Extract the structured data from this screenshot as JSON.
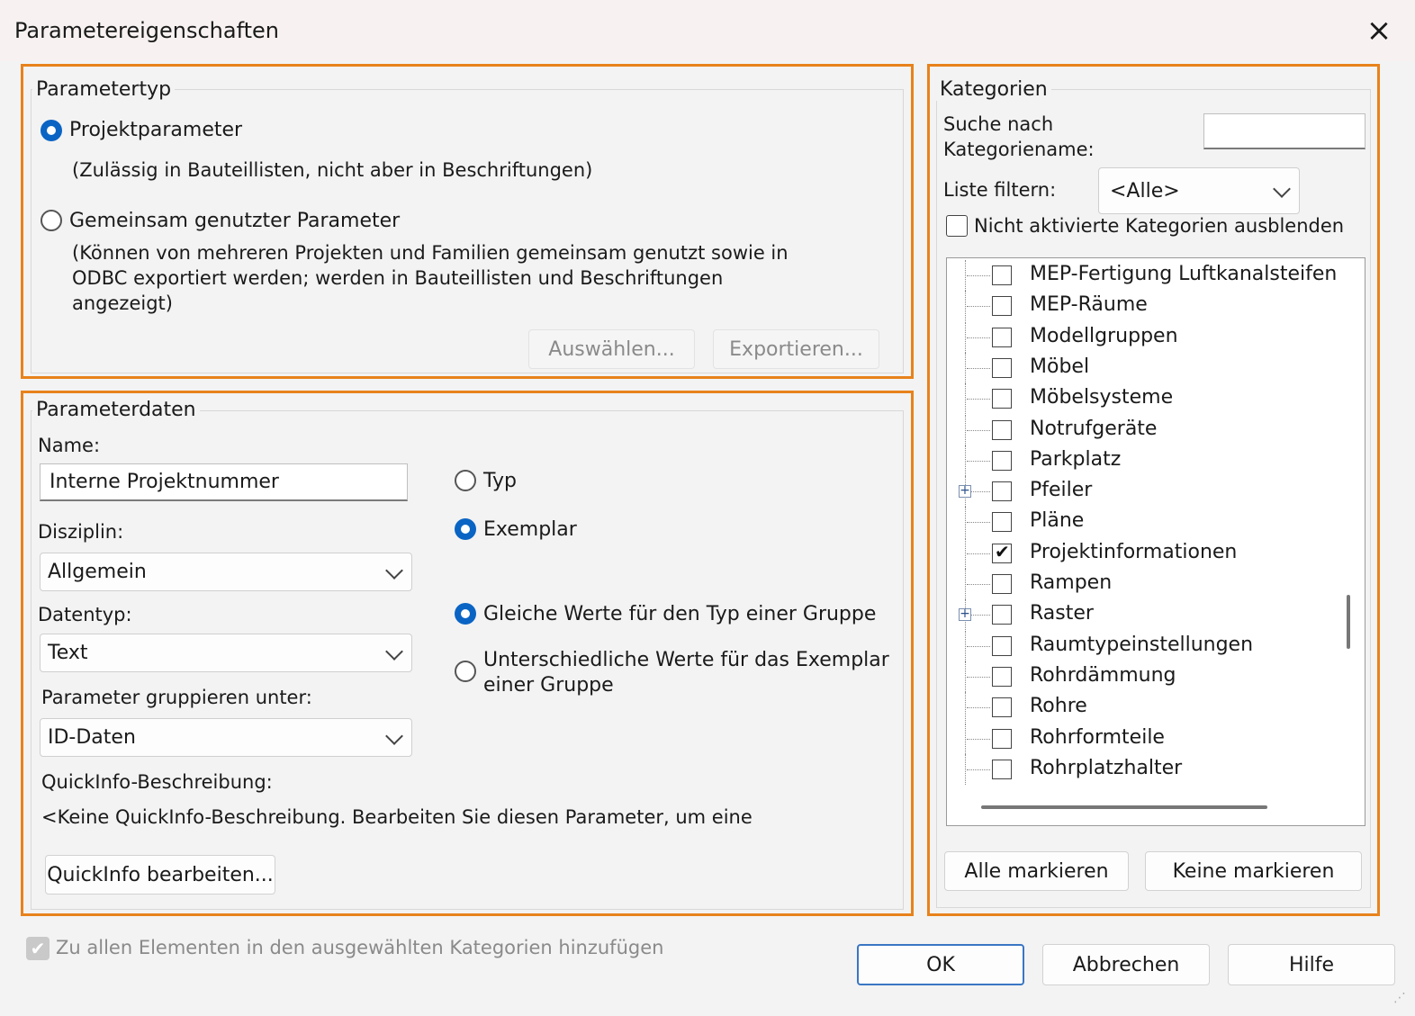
{
  "window": {
    "title": "Parametereigenschaften",
    "close_glyph": "×"
  },
  "parametertyp": {
    "legend": "Parametertyp",
    "projekt": {
      "label": "Projektparameter",
      "selected": true,
      "desc": "(Zulässig in Bauteillisten, nicht aber in Beschriftungen)"
    },
    "gemeinsam": {
      "label": "Gemeinsam genutzter Parameter",
      "selected": false,
      "desc_lines": [
        "(Können von mehreren Projekten und Familien gemeinsam genutzt sowie in",
        "ODBC exportiert werden; werden in Bauteillisten und Beschriftungen",
        "angezeigt)"
      ]
    },
    "auswaehlen_button": "Auswählen...",
    "exportieren_button": "Exportieren..."
  },
  "parameterdaten": {
    "legend": "Parameterdaten",
    "name_label": "Name:",
    "name_value": "Interne Projektnummer",
    "disziplin_label": "Disziplin:",
    "disziplin_value": "Allgemein",
    "datentyp_label": "Datentyp:",
    "datentyp_value": "Text",
    "gruppieren_label": "Parameter gruppieren unter:",
    "gruppieren_value": "ID-Daten",
    "typ_radio": {
      "label": "Typ",
      "selected": false
    },
    "exemplar_radio": {
      "label": "Exemplar",
      "selected": true
    },
    "gleiche_radio": {
      "label": "Gleiche Werte für den Typ einer Gruppe",
      "selected": true
    },
    "unterschiedliche_radio": {
      "label_line1": "Unterschiedliche Werte für das Exemplar",
      "label_line2": "einer Gruppe",
      "selected": false
    },
    "quickinfo_label": "QuickInfo-Beschreibung:",
    "quickinfo_text": "<Keine QuickInfo-Beschreibung. Bearbeiten Sie diesen Parameter, um eine",
    "quickinfo_button": "QuickInfo bearbeiten..."
  },
  "kategorien": {
    "legend": "Kategorien",
    "suche_label_line1": "Suche nach",
    "suche_label_line2": "Kategoriename:",
    "suche_value": "",
    "filter_label": "Liste filtern:",
    "filter_value": "<Alle>",
    "hide_checkbox": {
      "label": "Nicht aktivierte Kategorien ausblenden",
      "checked": false
    },
    "items": [
      {
        "label": "MEP-Fertigung Luftkanalsteifen",
        "checked": false,
        "expandable": false
      },
      {
        "label": "MEP-Räume",
        "checked": false,
        "expandable": false
      },
      {
        "label": "Modellgruppen",
        "checked": false,
        "expandable": false
      },
      {
        "label": "Möbel",
        "checked": false,
        "expandable": false
      },
      {
        "label": "Möbelsysteme",
        "checked": false,
        "expandable": false
      },
      {
        "label": "Notrufgeräte",
        "checked": false,
        "expandable": false
      },
      {
        "label": "Parkplatz",
        "checked": false,
        "expandable": false
      },
      {
        "label": "Pfeiler",
        "checked": false,
        "expandable": true
      },
      {
        "label": "Pläne",
        "checked": false,
        "expandable": false
      },
      {
        "label": "Projektinformationen",
        "checked": true,
        "expandable": false
      },
      {
        "label": "Rampen",
        "checked": false,
        "expandable": false
      },
      {
        "label": "Raster",
        "checked": false,
        "expandable": true
      },
      {
        "label": "Raumtypeinstellungen",
        "checked": false,
        "expandable": false
      },
      {
        "label": "Rohrdämmung",
        "checked": false,
        "expandable": false
      },
      {
        "label": "Rohre",
        "checked": false,
        "expandable": false
      },
      {
        "label": "Rohrformteile",
        "checked": false,
        "expandable": false
      },
      {
        "label": "Rohrplatzhalter",
        "checked": false,
        "expandable": false
      }
    ],
    "alle_button": "Alle markieren",
    "keine_button": "Keine markieren"
  },
  "footer": {
    "add_all_checkbox": {
      "label": "Zu allen Elementen in den ausgewählten Kategorien hinzufügen",
      "checked": true,
      "disabled": true
    },
    "ok_button": "OK",
    "abbrechen_button": "Abbrechen",
    "hilfe_button": "Hilfe"
  },
  "colors": {
    "highlight_border": "#e8821b",
    "accent": "#0a64c4"
  }
}
